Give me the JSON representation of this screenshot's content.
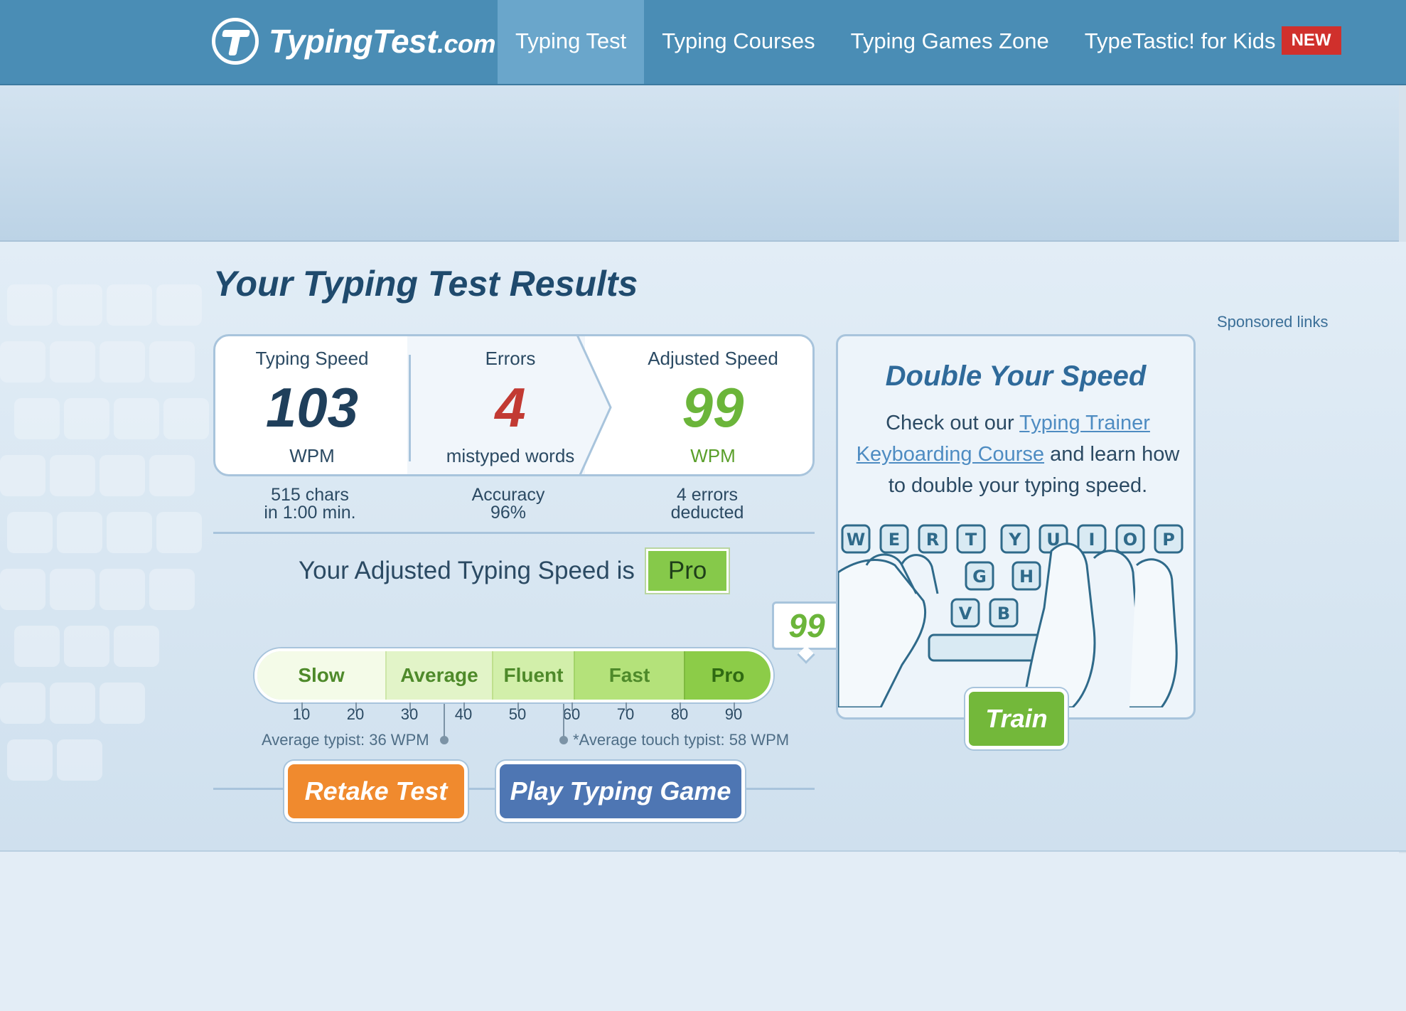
{
  "header": {
    "logo_text": "TypingTest",
    "logo_suffix": ".com",
    "nav": [
      {
        "label": "Typing Test"
      },
      {
        "label": "Typing Courses"
      },
      {
        "label": "Typing Games Zone"
      },
      {
        "label": "TypeTastic! for Kids"
      }
    ],
    "new_badge": "NEW"
  },
  "main": {
    "title": "Your Typing Test Results",
    "sponsored": "Sponsored links",
    "results": {
      "typing_speed": {
        "label": "Typing Speed",
        "value": "103",
        "unit": "WPM"
      },
      "errors": {
        "label": "Errors",
        "value": "4",
        "unit": "mistyped words"
      },
      "adjusted_speed": {
        "label": "Adjusted Speed",
        "value": "99",
        "unit": "WPM"
      }
    },
    "substats": {
      "chars_line1": "515 chars",
      "chars_line2": "in 1:00 min.",
      "accuracy_line1": "Accuracy",
      "accuracy_line2": "96%",
      "deducted_line1": "4 errors",
      "deducted_line2": "deducted"
    },
    "adjusted_text": "Your Adjusted Typing Speed is",
    "level": "Pro",
    "scale": {
      "segments": [
        "Slow",
        "Average",
        "Fluent",
        "Fast",
        "Pro"
      ],
      "ticks": [
        "10",
        "20",
        "30",
        "40",
        "50",
        "60",
        "70",
        "80",
        "90"
      ],
      "average_typist": "Average typist: 36 WPM",
      "touch_typist": "*Average touch typist: 58 WPM",
      "marker_value": "99"
    },
    "buttons": {
      "retake": "Retake Test",
      "play": "Play Typing Game"
    }
  },
  "promo": {
    "title": "Double Your Speed",
    "text_before": "Check out our ",
    "link1": "Typing Trainer",
    "link2": "Keyboarding Course",
    "text_after": " and learn how to double your typing speed.",
    "keys": [
      "W",
      "E",
      "R",
      "T",
      "Y",
      "U",
      "I",
      "O",
      "P",
      "G",
      "H",
      "V",
      "B"
    ],
    "train_button": "Train"
  },
  "colors": {
    "header": "#4a8db5",
    "accent_green": "#6bb53a",
    "error_red": "#c23a33",
    "retake_orange": "#f08a2e",
    "play_blue": "#4e76b3"
  }
}
